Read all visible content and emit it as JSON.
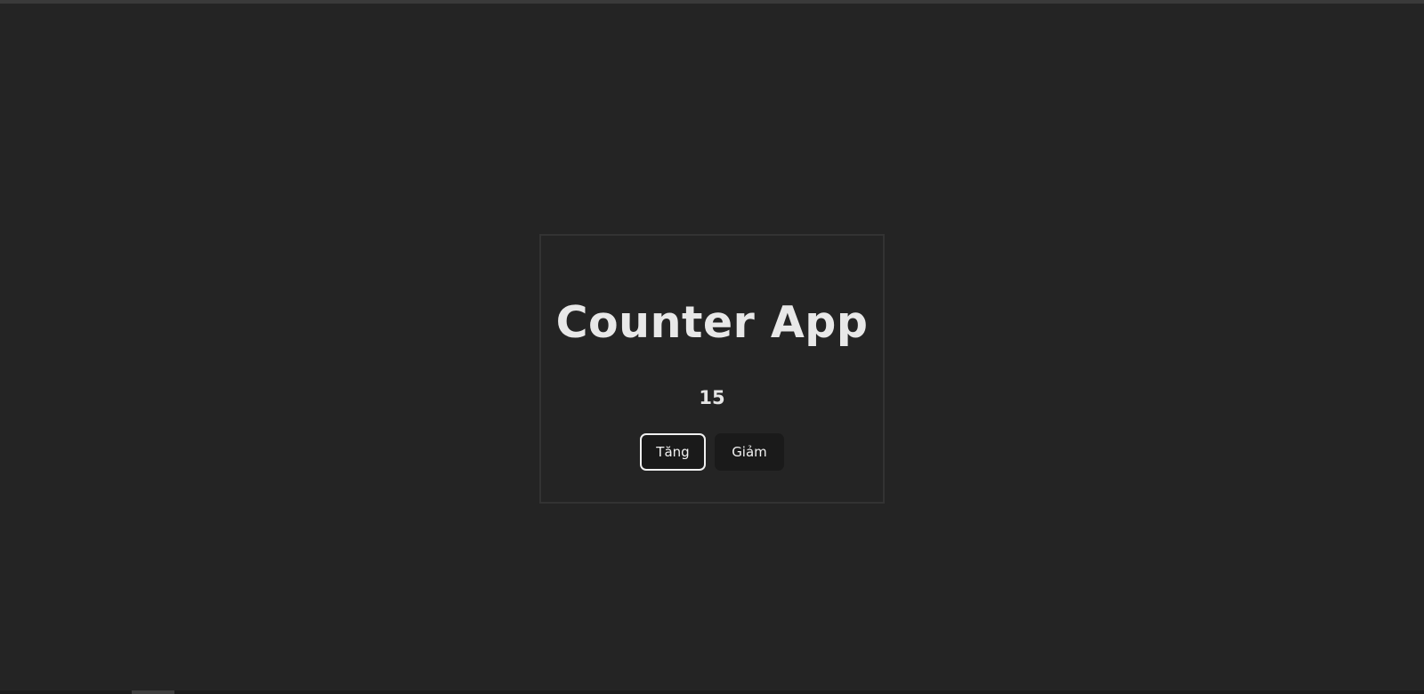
{
  "app": {
    "title": "Counter App",
    "count": "15",
    "increment_label": "Tăng",
    "decrement_label": "Giảm"
  },
  "colors": {
    "background": "#242424",
    "card_border": "#333333",
    "text": "#e8e8e8",
    "button_bg": "#1a1a1a",
    "focus_outline": "#f0f0f0"
  }
}
